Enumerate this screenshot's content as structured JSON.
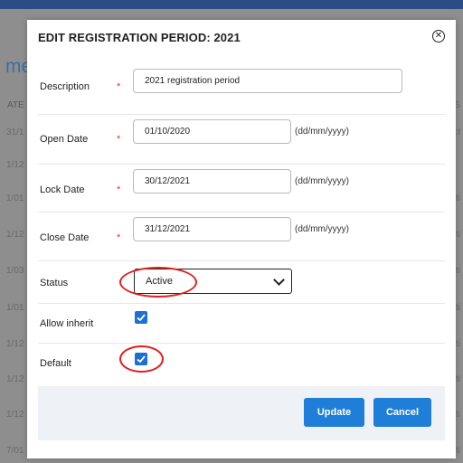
{
  "background": {
    "heading": "me",
    "col_header": "ATE",
    "col_header_right": "S",
    "rows": [
      "31/1",
      "1/12",
      "1/01",
      "1/12",
      "1/03",
      "1/01",
      "1/12",
      "1/12",
      "1/12",
      "7/01"
    ],
    "right_rows": [
      "ct",
      "ti",
      "ti",
      "ti",
      "ti",
      "ti",
      "ti",
      "ti",
      "ti"
    ]
  },
  "modal": {
    "title": "EDIT REGISTRATION PERIOD: 2021",
    "close_icon": "circle-x-icon",
    "required_marker": "*",
    "fields": {
      "description": {
        "label": "Description",
        "value": "2021 registration period"
      },
      "open_date": {
        "label": "Open Date",
        "value": "01/10/2020",
        "hint": "(dd/mm/yyyy)"
      },
      "lock_date": {
        "label": "Lock Date",
        "value": "30/12/2021",
        "hint": "(dd/mm/yyyy)"
      },
      "close_date": {
        "label": "Close Date",
        "value": "31/12/2021",
        "hint": "(dd/mm/yyyy)"
      },
      "status": {
        "label": "Status",
        "value": "Active"
      },
      "allow_inherit": {
        "label": "Allow inherit",
        "checked": true
      },
      "default": {
        "label": "Default",
        "checked": true
      }
    },
    "buttons": {
      "update": "Update",
      "cancel": "Cancel"
    }
  },
  "colors": {
    "accent": "#1f7fd8",
    "annotation": "#e02020",
    "header_bar": "#2a4d86"
  }
}
